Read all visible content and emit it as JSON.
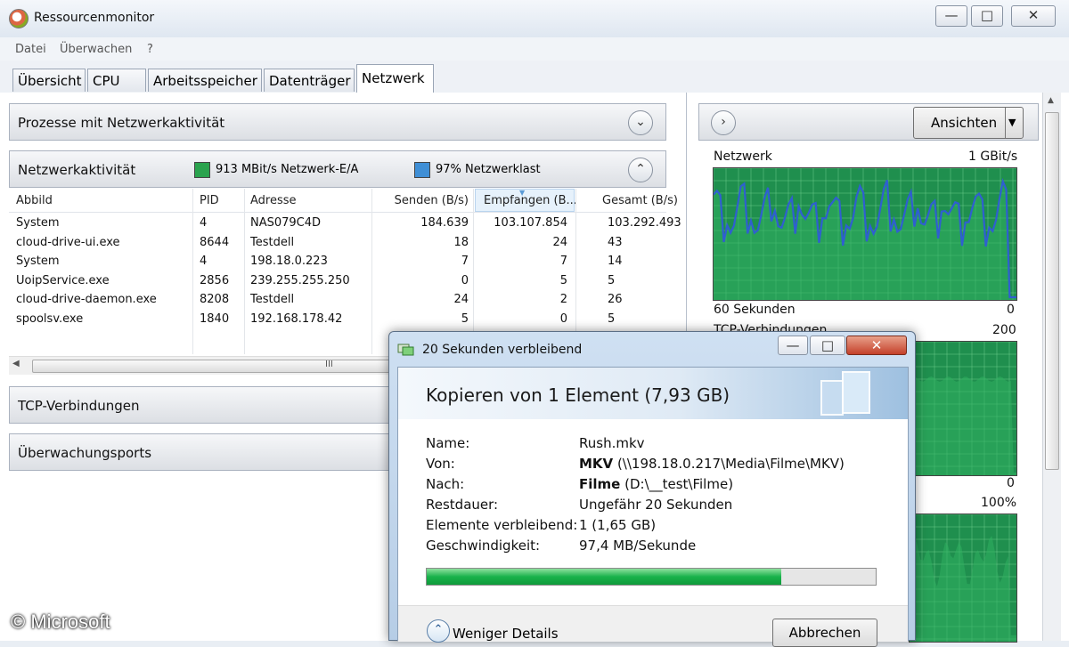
{
  "window": {
    "title": "Ressourcenmonitor",
    "controls": {
      "minimize": "—",
      "maximize": "□",
      "close": "✕"
    }
  },
  "menu": [
    "Datei",
    "Überwachen",
    "?"
  ],
  "tabs": [
    {
      "label": "Übersicht",
      "active": false
    },
    {
      "label": "CPU",
      "active": false
    },
    {
      "label": "Arbeitsspeicher",
      "active": false
    },
    {
      "label": "Datenträger",
      "active": false
    },
    {
      "label": "Netzwerk",
      "active": true
    }
  ],
  "sections": {
    "processes": "Prozesse mit Netzwerkaktivität",
    "network_activity": {
      "label": "Netzwerkaktivität",
      "legend_io": "913 MBit/s Netzwerk-E/A",
      "legend_io_color": "#2aa34e",
      "legend_load": "97% Netzwerklast",
      "legend_load_color": "#3f8fd6"
    },
    "tcp": "TCP-Verbindungen",
    "ports": "Überwachungsports"
  },
  "table": {
    "columns": [
      "Abbild",
      "PID",
      "Adresse",
      "Senden (B/s)",
      "Empfangen (B...",
      "Gesamt (B/s)"
    ],
    "rows": [
      [
        "System",
        "4",
        "NAS079C4D",
        "184.639",
        "103.107.854",
        "103.292.493"
      ],
      [
        "cloud-drive-ui.exe",
        "8644",
        "Testdell",
        "18",
        "24",
        "43"
      ],
      [
        "System",
        "4",
        "198.18.0.223",
        "7",
        "7",
        "14"
      ],
      [
        "UoipService.exe",
        "2856",
        "239.255.255.250",
        "0",
        "5",
        "5"
      ],
      [
        "cloud-drive-daemon.exe",
        "8208",
        "Testdell",
        "24",
        "2",
        "26"
      ],
      [
        "spoolsv.exe",
        "1840",
        "192.168.178.42",
        "5",
        "0",
        "5"
      ]
    ],
    "hscroll_grip": "III"
  },
  "right": {
    "views_button": "Ansichten",
    "graph1": {
      "title": "Netzwerk",
      "max": "1 GBit/s",
      "footer": "60 Sekunden",
      "min": "0"
    },
    "graph2": {
      "title": "TCP-Verbindungen",
      "max": "200",
      "min": "0"
    },
    "graph3": {
      "max": "100%"
    },
    "graph_line_color": "#2f5fd0",
    "graph_fill_color": "#1f8f4e"
  },
  "dialog": {
    "title": "20 Sekunden verbleibend",
    "heading": "Kopieren von 1 Element (7,93 GB)",
    "fields": [
      {
        "key": "Name:",
        "value_bold": "",
        "value": "Rush.mkv"
      },
      {
        "key": "Von:",
        "value_bold": "MKV",
        "value": " (\\\\198.18.0.217\\Media\\Filme\\MKV)"
      },
      {
        "key": "Nach:",
        "value_bold": "Filme",
        "value": " (D:\\__test\\Filme)"
      },
      {
        "key": "Restdauer:",
        "value_bold": "",
        "value": "Ungefähr 20 Sekunden"
      },
      {
        "key": "Elemente verbleibend:",
        "value_bold": "",
        "value": "1 (1,65 GB)"
      },
      {
        "key": "Geschwindigkeit:",
        "value_bold": "",
        "value": "97,4 MB/Sekunde"
      }
    ],
    "progress": 0.79,
    "less_details": "Weniger Details",
    "cancel": "Abbrechen"
  },
  "watermark": "© Microsoft"
}
